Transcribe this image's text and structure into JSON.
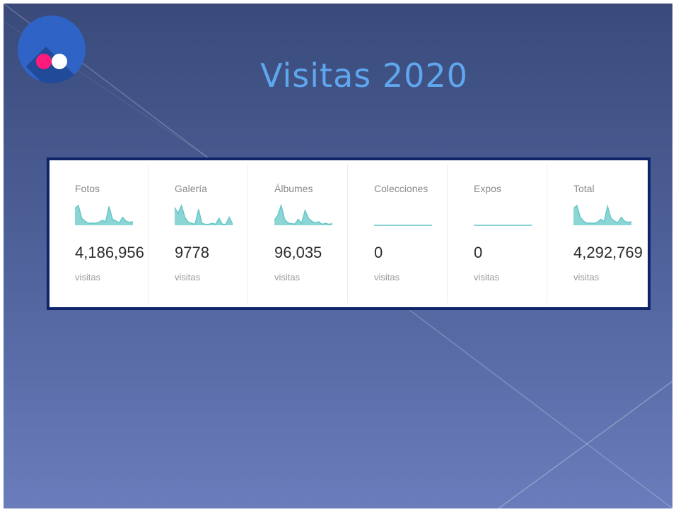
{
  "title": "Visitas 2020",
  "logo": {
    "icon": "flickr-logo",
    "colors": {
      "circle": "#2f63c6",
      "pink": "#ff1a7a",
      "white": "#ffffff"
    }
  },
  "accent_color": "#66c7c7",
  "stats": [
    {
      "label": "Fotos",
      "value": "4,186,956",
      "unit": "visitas",
      "sparkline": [
        0.85,
        1.0,
        0.35,
        0.2,
        0.1,
        0.12,
        0.1,
        0.15,
        0.25,
        0.18,
        0.95,
        0.3,
        0.22,
        0.12,
        0.4,
        0.2,
        0.15,
        0.18
      ]
    },
    {
      "label": "Galería",
      "value": "9778",
      "unit": "visitas",
      "sparkline": [
        0.9,
        0.6,
        1.0,
        0.4,
        0.15,
        0.1,
        0.05,
        0.8,
        0.1,
        0.05,
        0.05,
        0.1,
        0.05,
        0.35,
        0.05,
        0.05,
        0.4,
        0.05
      ]
    },
    {
      "label": "Álbumes",
      "value": "96,035",
      "unit": "visitas",
      "sparkline": [
        0.25,
        0.5,
        1.0,
        0.3,
        0.12,
        0.08,
        0.06,
        0.3,
        0.1,
        0.75,
        0.35,
        0.2,
        0.12,
        0.18,
        0.05,
        0.1,
        0.05,
        0.08
      ]
    },
    {
      "label": "Colecciones",
      "value": "0",
      "unit": "visitas",
      "sparkline": [
        0,
        0,
        0,
        0,
        0,
        0,
        0,
        0,
        0,
        0,
        0,
        0,
        0,
        0,
        0,
        0,
        0,
        0
      ]
    },
    {
      "label": "Expos",
      "value": "0",
      "unit": "visitas",
      "sparkline": [
        0,
        0,
        0,
        0,
        0,
        0,
        0,
        0,
        0,
        0,
        0,
        0,
        0,
        0,
        0,
        0,
        0,
        0
      ]
    },
    {
      "label": "Total",
      "value": "4,292,769",
      "unit": "visitas",
      "sparkline": [
        0.85,
        1.0,
        0.4,
        0.2,
        0.1,
        0.12,
        0.1,
        0.15,
        0.3,
        0.2,
        0.95,
        0.35,
        0.22,
        0.12,
        0.4,
        0.2,
        0.15,
        0.18
      ]
    }
  ]
}
